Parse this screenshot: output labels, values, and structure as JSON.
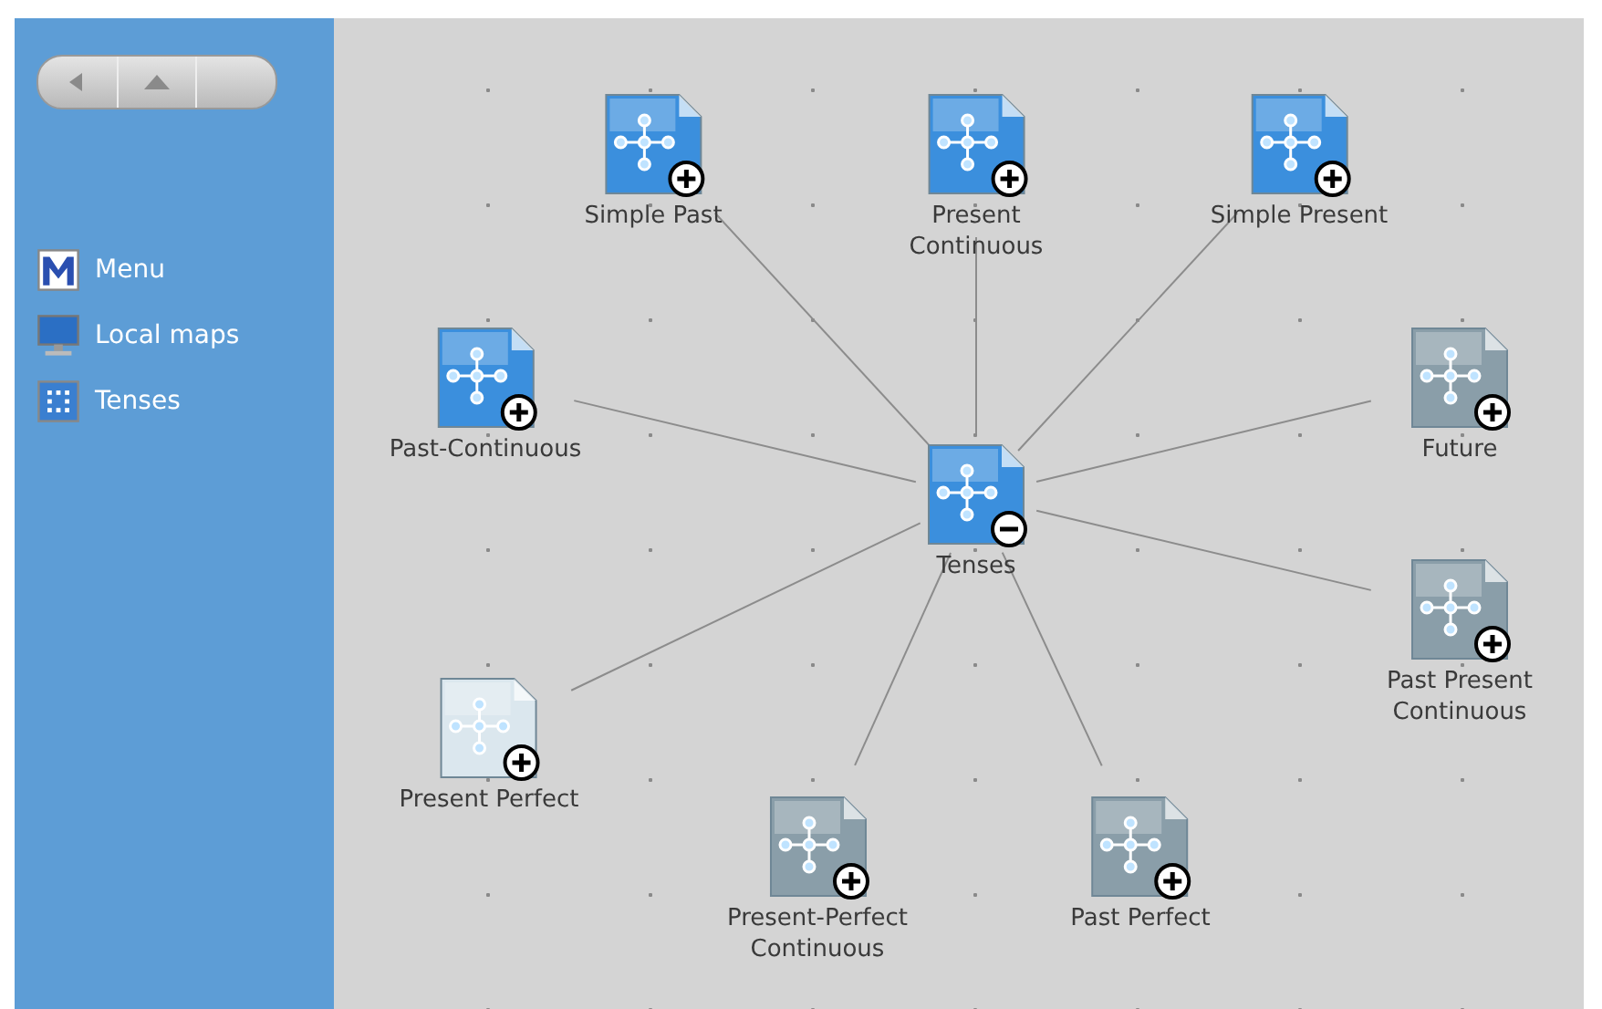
{
  "sidebar": {
    "items": [
      {
        "label": "Menu",
        "kind": "menu"
      },
      {
        "label": "Local maps",
        "kind": "monitor"
      },
      {
        "label": "Tenses",
        "kind": "map"
      }
    ]
  },
  "map": {
    "center": {
      "label": "Tenses",
      "expanded": true,
      "color": "#3b8fdd"
    },
    "nodes": [
      {
        "label": "Simple Past",
        "expanded": false,
        "color": "#3b8fdd"
      },
      {
        "label": "Present\nContinuous",
        "expanded": false,
        "color": "#3b8fdd"
      },
      {
        "label": "Simple Present",
        "expanded": false,
        "color": "#3b8fdd"
      },
      {
        "label": "Past-Continuous",
        "expanded": false,
        "color": "#3b8fdd"
      },
      {
        "label": "Future",
        "expanded": false,
        "color": "#8a9ea9"
      },
      {
        "label": "Past Present\nContinuous",
        "expanded": false,
        "color": "#8a9ea9"
      },
      {
        "label": "Present Perfect",
        "expanded": false,
        "color": "#dbe7ee"
      },
      {
        "label": "Present-Perfect\nContinuous",
        "expanded": false,
        "color": "#8a9ea9"
      },
      {
        "label": "Past Perfect",
        "expanded": false,
        "color": "#8a9ea9"
      }
    ]
  }
}
